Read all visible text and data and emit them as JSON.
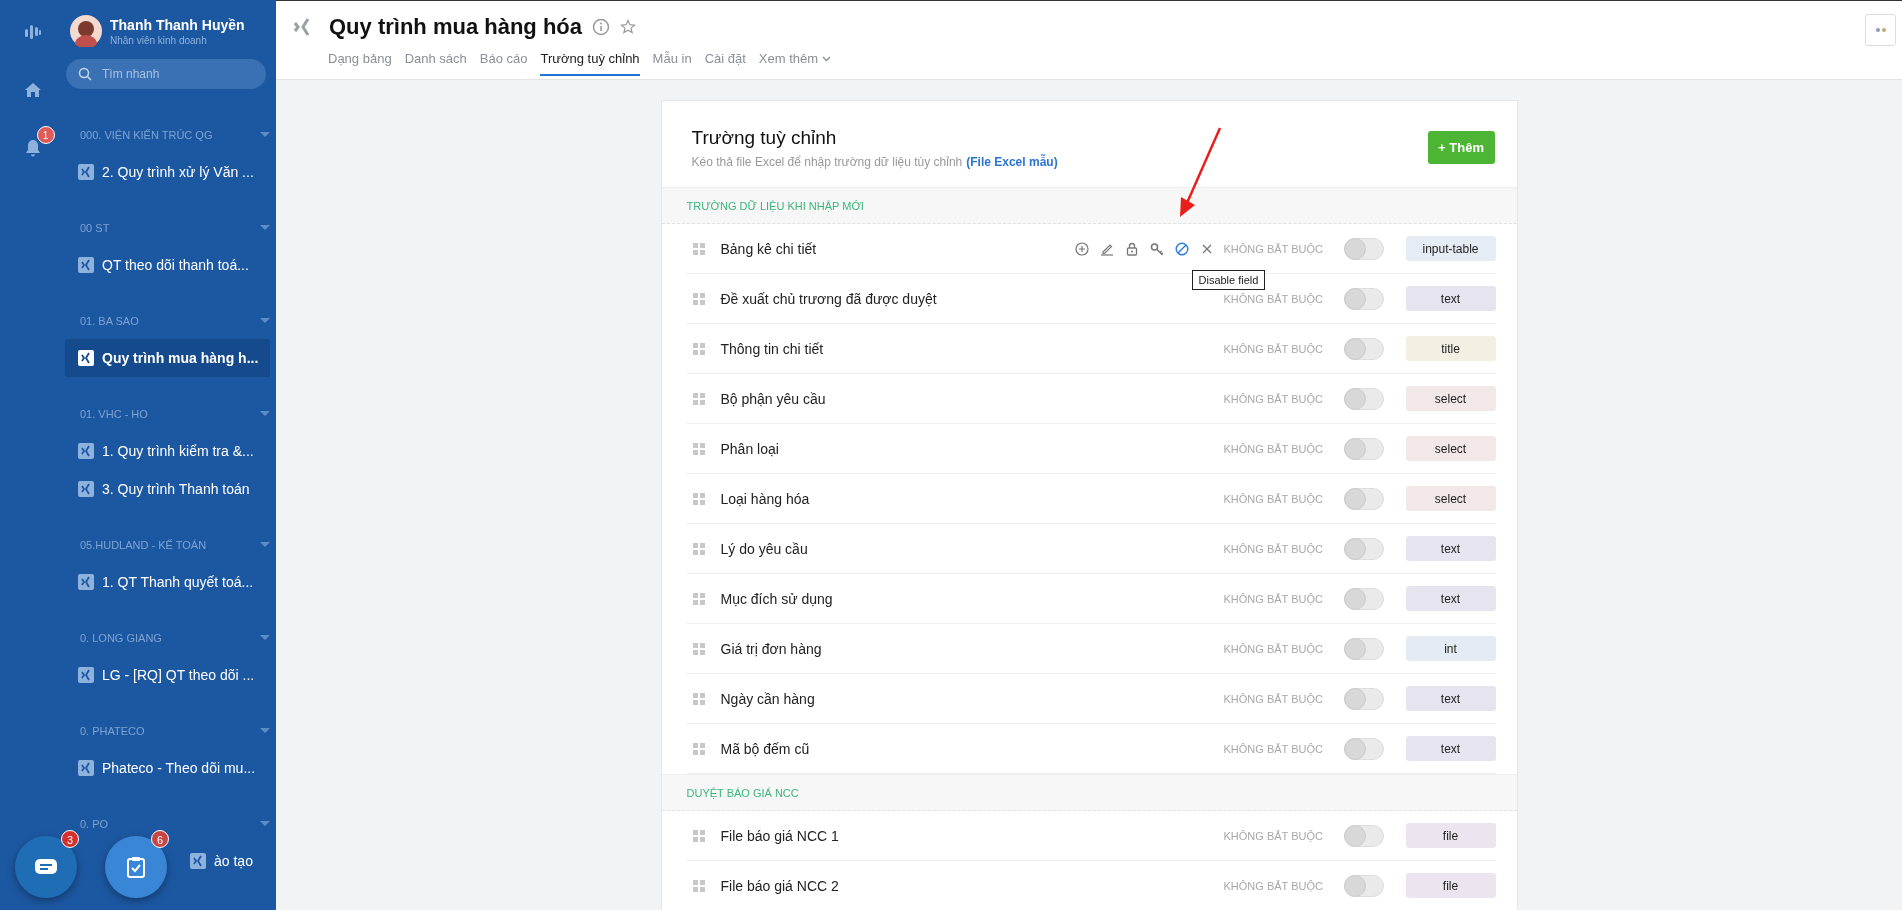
{
  "sidebar": {
    "user": {
      "name": "Thanh Thanh Huyền",
      "role": "Nhân viên kinh doanh"
    },
    "search": {
      "placeholder": "Tìm nhanh"
    },
    "notification_badge": "1",
    "groups": [
      {
        "label": "000. VIỆN KIẾN TRÚC QG",
        "items": [
          {
            "label": "2. Quy trình xử lý Văn ...",
            "selected": false
          }
        ]
      },
      {
        "label": "00 ST",
        "items": [
          {
            "label": "QT theo dõi thanh toá...",
            "selected": false
          }
        ]
      },
      {
        "label": "01. BA SAO",
        "items": [
          {
            "label": "Quy trình mua hàng h...",
            "selected": true
          }
        ]
      },
      {
        "label": "01. VHC - HO",
        "items": [
          {
            "label": "1. Quy trình kiểm tra &...",
            "selected": false
          },
          {
            "label": "3. Quy trình Thanh toán",
            "selected": false
          }
        ]
      },
      {
        "label": "05.HUDLAND - KẾ TOÁN",
        "items": [
          {
            "label": "1. QT Thanh quyết toá...",
            "selected": false
          }
        ]
      },
      {
        "label": "0. LONG GIANG",
        "items": [
          {
            "label": "LG - [RQ] QT theo dõi ...",
            "selected": false
          }
        ]
      },
      {
        "label": "0. PHATECO",
        "items": [
          {
            "label": "Phateco - Theo dõi mu...",
            "selected": false
          }
        ]
      },
      {
        "label": "0. PO",
        "items": [
          {
            "label": "ào tạo",
            "selected": false
          }
        ]
      }
    ]
  },
  "floating": {
    "chat_badge": "3",
    "tasks_badge": "6"
  },
  "header": {
    "title": "Quy trình mua hàng hóa",
    "tabs": [
      {
        "label": "Dạng bảng",
        "selected": false,
        "kind": "tab"
      },
      {
        "label": "Danh sách",
        "selected": false,
        "kind": "tab"
      },
      {
        "label": "Báo cáo",
        "selected": false,
        "kind": "tab"
      },
      {
        "label": "Trường tuỳ chỉnh",
        "selected": true,
        "kind": "tab"
      },
      {
        "label": "Mẫu in",
        "selected": false,
        "kind": "tab"
      },
      {
        "label": "Cài đặt",
        "selected": false,
        "kind": "tab"
      },
      {
        "label": "Xem thêm",
        "selected": false,
        "kind": "dropdown"
      }
    ]
  },
  "card": {
    "title": "Trường tuỳ chỉnh",
    "subtitle": "Kéo thả file Excel để nhập trường dữ liệu tùy chỉnh",
    "template_link": "(File Excel mẫu)",
    "add_button": "+ Thêm",
    "sections": [
      {
        "title": "TRƯỜNG DỮ LIỆU KHI NHẬP MỚI",
        "rows": [
          {
            "label": "Bảng kê chi tiết",
            "required": "KHÔNG BẮT BUỘC",
            "on": false,
            "type": "input-table",
            "color": "#e6ecf3",
            "actions": [
              {
                "kind": "add",
                "active": false
              },
              {
                "kind": "edit",
                "active": false
              },
              {
                "kind": "lock",
                "active": false
              },
              {
                "kind": "key",
                "active": false
              },
              {
                "kind": "disable",
                "active": true,
                "tooltip": "Disable field"
              },
              {
                "kind": "delete",
                "active": false
              }
            ]
          },
          {
            "label": "Đề xuất chủ trương đã được duyệt",
            "required": "KHÔNG BẮT BUỘC",
            "on": false,
            "type": "text",
            "color": "#e6e4ef"
          },
          {
            "label": "Thông tin chi tiết",
            "required": "KHÔNG BẮT BUỘC",
            "on": false,
            "type": "title",
            "color": "#f4efe3"
          },
          {
            "label": "Bộ phận yêu cầu",
            "required": "KHÔNG BẮT BUỘC",
            "on": false,
            "type": "select",
            "color": "#f3e8e8"
          },
          {
            "label": "Phân loại",
            "required": "KHÔNG BẮT BUỘC",
            "on": false,
            "type": "select",
            "color": "#f3e8e8"
          },
          {
            "label": "Loại hàng hóa",
            "required": "KHÔNG BẮT BUỘC",
            "on": false,
            "type": "select",
            "color": "#f3e8e8"
          },
          {
            "label": "Lý do yêu cầu",
            "required": "KHÔNG BẮT BUỘC",
            "on": false,
            "type": "text",
            "color": "#e6e4ef"
          },
          {
            "label": "Mục đích sử dụng",
            "required": "KHÔNG BẮT BUỘC",
            "on": false,
            "type": "text",
            "color": "#e6e4ef"
          },
          {
            "label": "Giá trị đơn hàng",
            "required": "KHÔNG BẮT BUỘC",
            "on": false,
            "type": "int",
            "color": "#e4ebf3"
          },
          {
            "label": "Ngày cần hàng",
            "required": "KHÔNG BẮT BUỘC",
            "on": false,
            "type": "text",
            "color": "#e6e4ef"
          },
          {
            "label": "Mã bộ đếm cũ",
            "required": "KHÔNG BẮT BUỘC",
            "on": false,
            "type": "text",
            "color": "#e6e4ef"
          }
        ]
      },
      {
        "title": "DUYỆT BÁO GIÁ NCC",
        "rows": [
          {
            "label": "File báo giá NCC 1",
            "required": "KHÔNG BẮT BUỘC",
            "on": false,
            "type": "file",
            "color": "#ece4ef"
          },
          {
            "label": "File báo giá NCC 2",
            "required": "KHÔNG BẮT BUỘC",
            "on": false,
            "type": "file",
            "color": "#ece4ef"
          }
        ]
      }
    ]
  }
}
